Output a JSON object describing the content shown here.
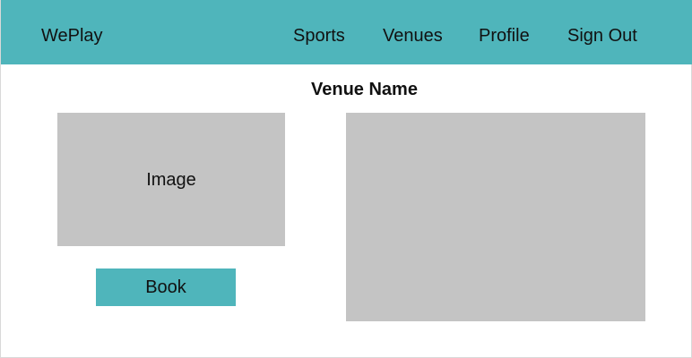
{
  "header": {
    "brand": "WePlay",
    "nav": {
      "sports": "Sports",
      "venues": "Venues",
      "profile": "Profile",
      "sign_out": "Sign Out"
    }
  },
  "main": {
    "venue_name": "Venue Name",
    "image_placeholder": "Image",
    "book_label": "Book"
  },
  "colors": {
    "accent": "#4fb5bb",
    "placeholder_gray": "#c4c4c4",
    "background": "#ffffff"
  }
}
